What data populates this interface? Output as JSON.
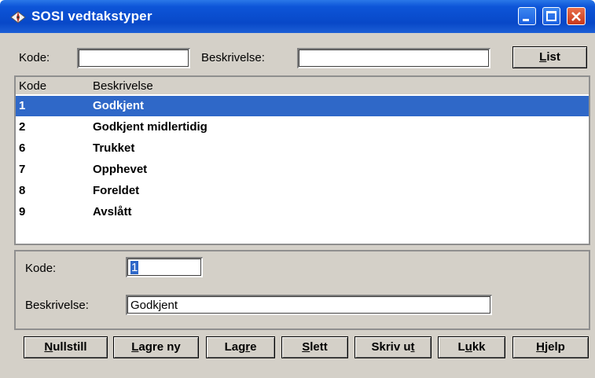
{
  "window": {
    "title": "SOSI vedtakstyper"
  },
  "search": {
    "kode_label": "Kode:",
    "kode_value": "",
    "beskrivelse_label": "Beskrivelse:",
    "beskrivelse_value": "",
    "list_button": "List",
    "list_button_rest": "ist",
    "list_button_accel": "L"
  },
  "list": {
    "headers": [
      "Kode",
      "Beskrivelse"
    ],
    "rows": [
      {
        "kode": "1",
        "beskrivelse": "Godkjent",
        "selected": true
      },
      {
        "kode": "2",
        "beskrivelse": "Godkjent midlertidig"
      },
      {
        "kode": "6",
        "beskrivelse": "Trukket"
      },
      {
        "kode": "7",
        "beskrivelse": "Opphevet"
      },
      {
        "kode": "8",
        "beskrivelse": "Foreldet"
      },
      {
        "kode": "9",
        "beskrivelse": "Avslått"
      }
    ]
  },
  "detail": {
    "kode_label": "Kode:",
    "kode_value": "1",
    "beskrivelse_label": "Beskrivelse:",
    "beskrivelse_value": "Godkjent"
  },
  "buttons": {
    "nullstill": {
      "accel": "N",
      "rest": "ullstill"
    },
    "lagre_ny": {
      "accel": "L",
      "rest": "agre ny"
    },
    "lagre": {
      "pre": "Lag",
      "accel": "r",
      "rest": "e"
    },
    "slett": {
      "accel": "S",
      "rest": "lett"
    },
    "skriv_ut": {
      "pre": "Skriv u",
      "accel": "t",
      "rest": ""
    },
    "lukk": {
      "pre": "L",
      "accel": "u",
      "rest": "kk"
    },
    "hjelp": {
      "accel": "H",
      "rest": "jelp"
    }
  },
  "colors": {
    "titlebar": "#0d55d8",
    "selection": "#2f68c8",
    "face": "#d4d0c8"
  },
  "icons": {
    "app": "compass-icon",
    "minimize": "minimize-icon",
    "maximize": "maximize-icon",
    "close": "close-icon"
  }
}
